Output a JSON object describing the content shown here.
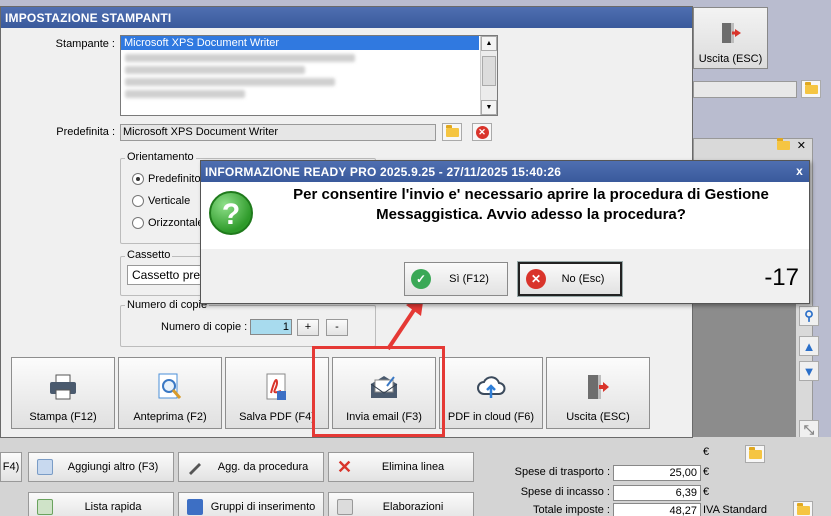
{
  "background_app": {
    "exit_button_label": "Uscita (ESC)",
    "bottom_buttons": [
      {
        "label": "F4)"
      },
      {
        "label": "Aggiungi altro (F3)"
      },
      {
        "label": "Agg. da procedura"
      },
      {
        "label": "Elimina linea"
      },
      {
        "label": "Lista rapida"
      },
      {
        "label": "Gruppi di inserimento"
      },
      {
        "label": "Elaborazioni"
      }
    ],
    "totals": {
      "shipping_label": "Spese di trasporto :",
      "shipping_value": "25,00",
      "collection_label": "Spese di incasso :",
      "collection_value": "6,39",
      "total_label": "Totale imposte :",
      "total_value": "48,27",
      "currency": "€",
      "vat_label": "IVA Standard"
    }
  },
  "printer_window": {
    "title": "IMPOSTAZIONE STAMPANTI",
    "printer_label": "Stampante :",
    "printer_list_selected": "Microsoft XPS Document Writer",
    "default_label": "Predefinita :",
    "default_value": "Microsoft XPS Document Writer",
    "orientation_legend": "Orientamento",
    "orientation_options": [
      "Predefinito",
      "Verticale",
      "Orizzontale"
    ],
    "tray_legend": "Cassetto",
    "tray_value": "Cassetto predefinito",
    "copies_legend": "Numero di copie",
    "copies_label": "Numero di copie :",
    "copies_value": "1",
    "plus": "+",
    "minus": "-",
    "actions": [
      {
        "label": "Stampa (F12)",
        "icon": "printer-icon"
      },
      {
        "label": "Anteprima (F2)",
        "icon": "preview-icon"
      },
      {
        "label": "Salva PDF (F4)",
        "icon": "pdf-icon"
      },
      {
        "label": "Invia email (F3)",
        "icon": "email-icon"
      },
      {
        "label": "PDF in cloud (F6)",
        "icon": "cloud-upload-icon"
      },
      {
        "label": "Uscita (ESC)",
        "icon": "exit-icon"
      }
    ]
  },
  "dialog": {
    "title": "INFORMAZIONE READY PRO 2025.9.25 - 27/11/2025 15:40:26",
    "close": "x",
    "message_line1": "Per consentire l'invio e' necessario aprire la procedura di Gestione",
    "message_line2": "Messaggistica. Avvio adesso la procedura?",
    "yes_label": "Sì (F12)",
    "no_label": "No (Esc)",
    "counter": "-17"
  },
  "colors": {
    "title_bar": "#3f62a6",
    "highlight": "#e53935",
    "yes_icon": "#3aa856",
    "no_icon": "#d9342b"
  }
}
